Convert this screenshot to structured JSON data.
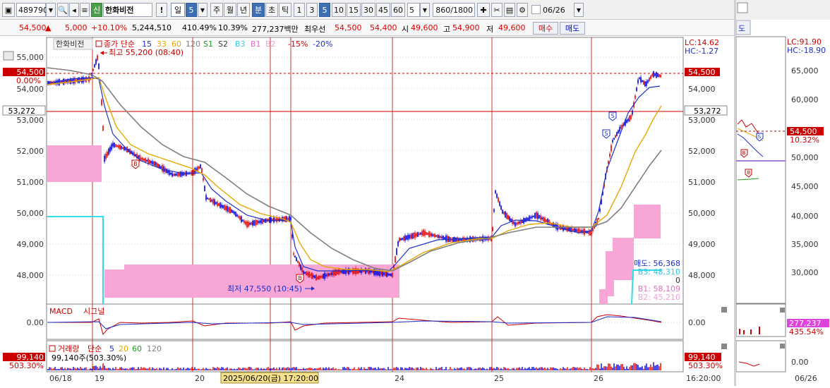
{
  "toolbar": {
    "code": "489790",
    "stock_badge": "신",
    "stock_name": "한화비전",
    "period_day": "일",
    "period_num": "5",
    "week": "주",
    "month": "월",
    "year": "년",
    "minute": "분",
    "second": "초",
    "tick": "틱",
    "intervals": [
      "1",
      "3",
      "5",
      "10",
      "15",
      "30",
      "45",
      "60"
    ],
    "interval_value": "5",
    "bar_count": "860/1800",
    "date": "06/26"
  },
  "quote": {
    "price": "54,500",
    "change_arrow": "▲",
    "change": "5,000",
    "change_pct": "+10.10%",
    "volume": "5,244,510",
    "volume_ratio": "410.49%",
    "turnover_pct": "10.39%",
    "amount": "277,237백만",
    "best_ask_label": "최우선",
    "best_ask": "54,500",
    "best_bid": "54,400",
    "open_label": "시",
    "open": "49,600",
    "high_label": "고",
    "high": "54,900",
    "low_label": "저",
    "low": "49,600",
    "buy_label": "매수",
    "sell_label": "매도"
  },
  "chart": {
    "stock_tag": "한화비전",
    "legend_close": "종가 단순",
    "ma": [
      "15",
      "33",
      "60",
      "120"
    ],
    "legend_signals": [
      "S1",
      "S2",
      "B3",
      "B1",
      "B2"
    ],
    "legend_pct": [
      "-15%",
      "-20%"
    ],
    "max_label": "최고 55,200 (08:40)",
    "min_label": "최저 47,550 (10:45)",
    "price_left_box": "54,500",
    "pct_left": "0.00%",
    "line_left_box": "53,272",
    "price_right_box": "54,500",
    "line_right_box": "53,272",
    "lc": "LC:14.62",
    "hc": "HC:-1.27",
    "y_ticks": [
      "55,000",
      "54,000",
      "53,000",
      "52,000",
      "51,000",
      "50,000",
      "49,000",
      "48,000"
    ],
    "sell_label": "매도: 56,368",
    "b3_label": "B3: 48,310",
    "zero_label": "0",
    "b1_label": "B1: 58,109",
    "b2_label": "B2: 45,210",
    "macd_label": "MACD",
    "signal_label": "시그널",
    "macd_zero": "0.00",
    "vol_label": "거래량",
    "vol_ma_label": "단순",
    "vol_ma": [
      "5",
      "20",
      "60",
      "120"
    ],
    "vol_value": "99,140주(503.30%)",
    "vol_box": "99,140",
    "vol_pct": "503.30%",
    "x_labels": [
      "06/18",
      "19",
      "20",
      "24",
      "25",
      "26"
    ],
    "x_time_right": "16:20:00",
    "crosshair_date": "2025/06/20(금) 17:20:00"
  },
  "right_pane": {
    "tab": "도",
    "lc": "LC:91.90",
    "hc": "HC:-18.90",
    "y_ticks": [
      "65,000",
      "60,000",
      "55,000",
      "50,000",
      "45,000",
      "40,000",
      "35,000",
      "30,000"
    ],
    "price_box": "54,500",
    "pct": "10.32%",
    "vol_box": "277,237",
    "vol_pct": "435.54%",
    "macd_zero": "0.00",
    "x_label": "06/26"
  },
  "colors": {
    "up": "#e00000",
    "down": "#0000e0",
    "ma15": "#1e2fc8",
    "ma33": "#e8a800",
    "ma60": "#808080",
    "pink_zone": "#f7a6d6",
    "price_line": "#cc0000"
  }
}
